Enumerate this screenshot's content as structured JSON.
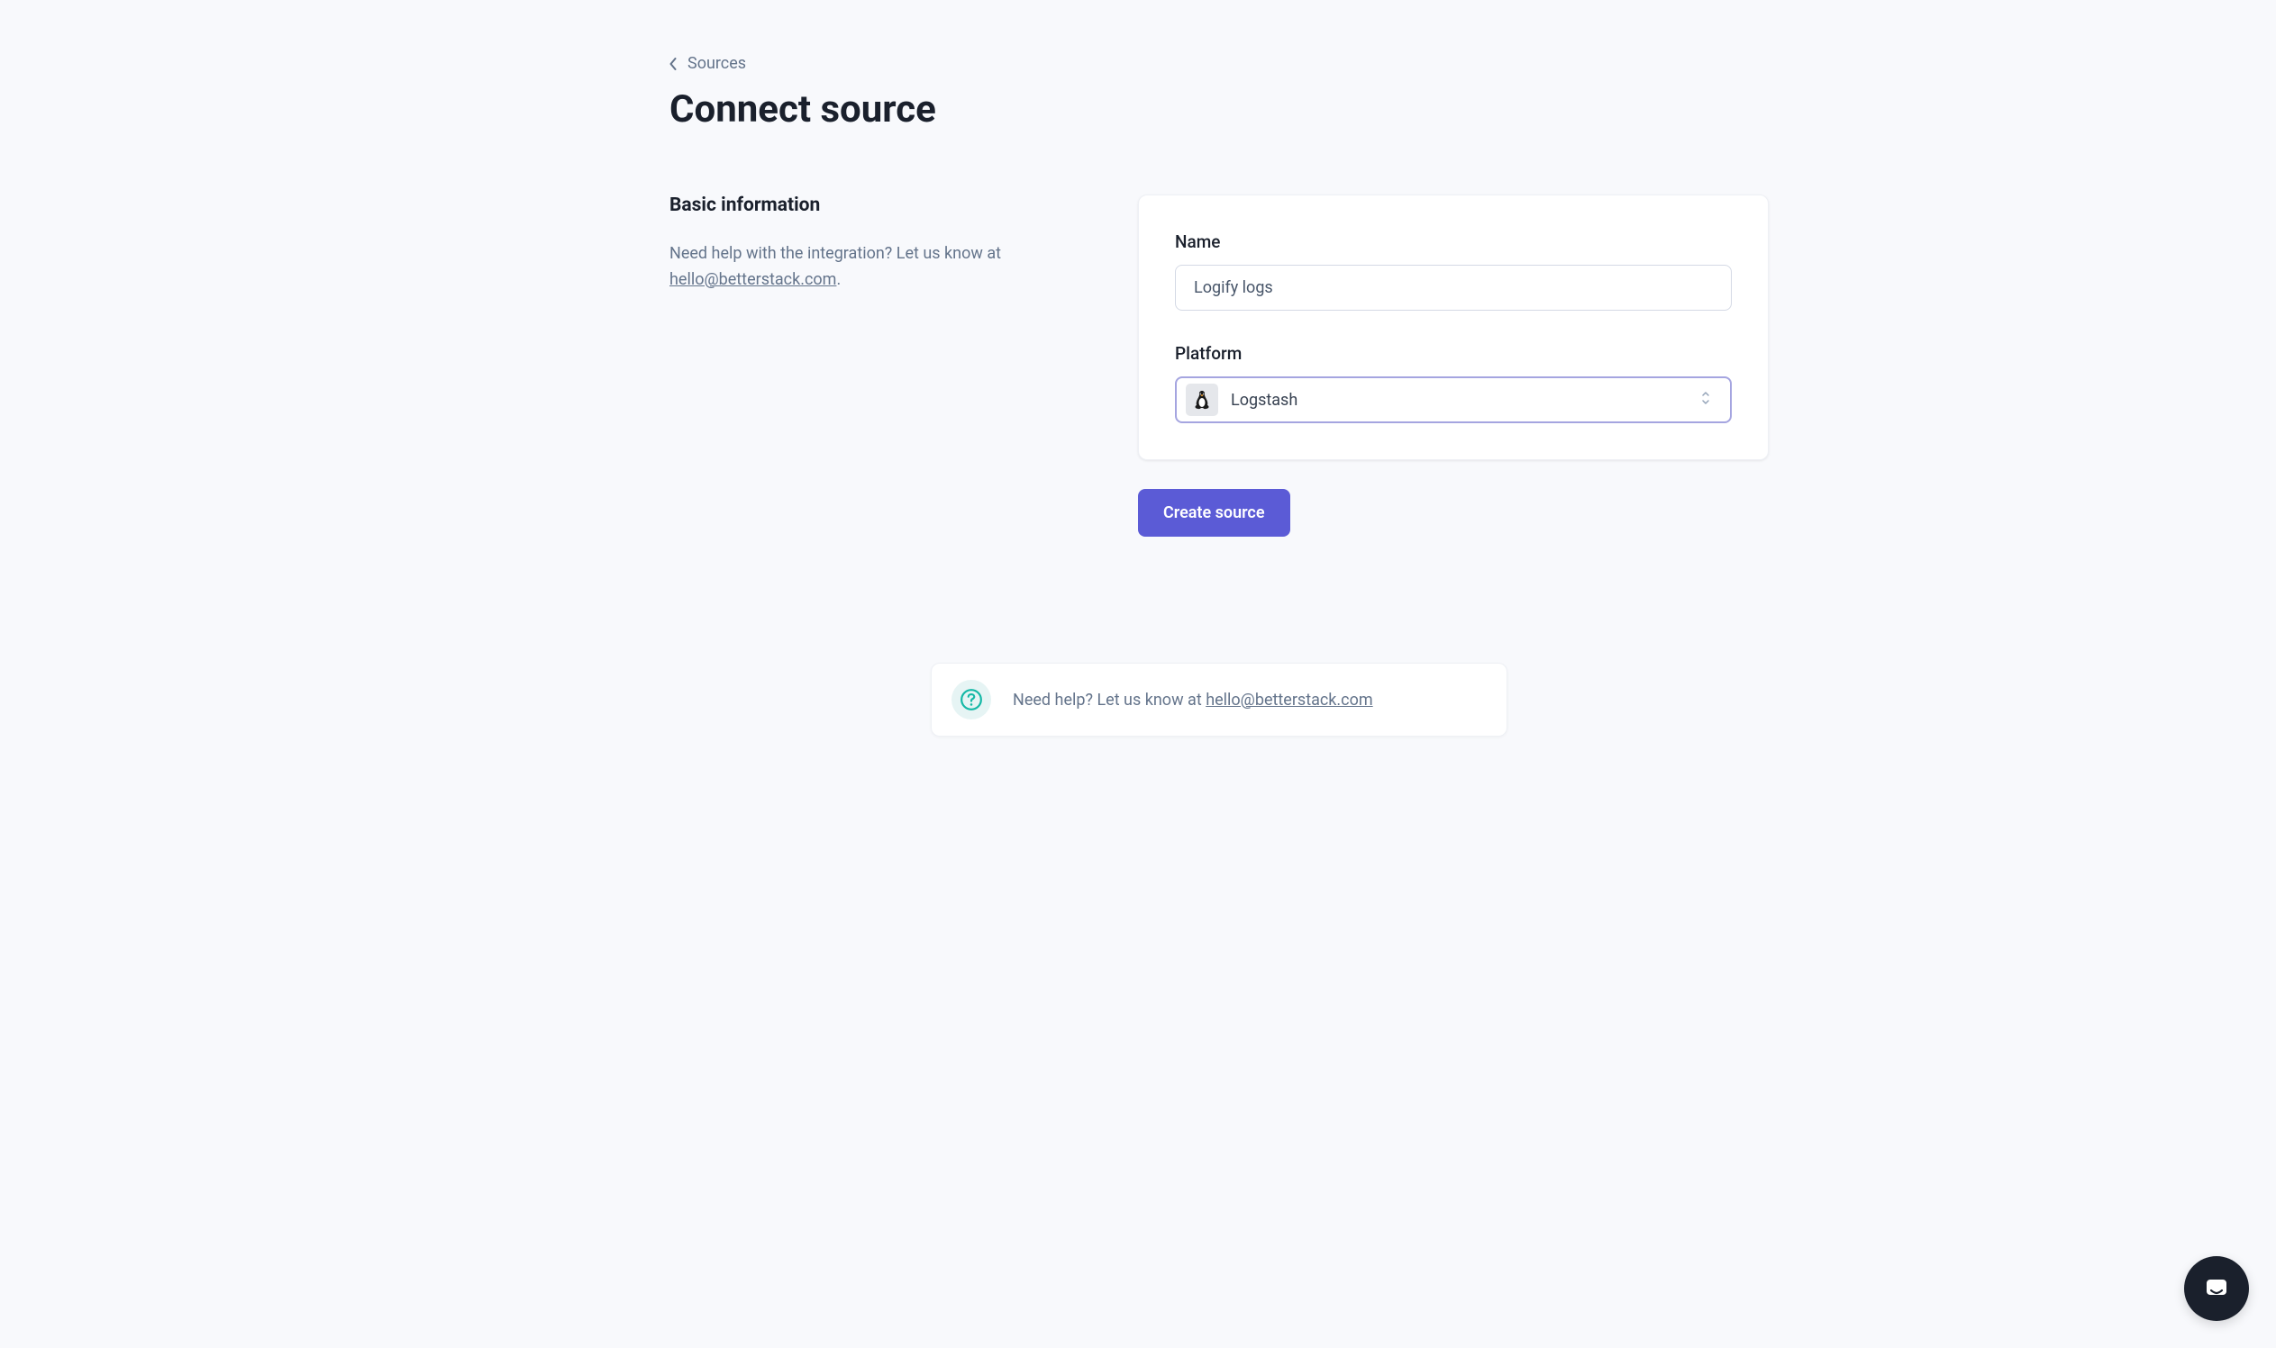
{
  "breadcrumb": {
    "parent": "Sources"
  },
  "page": {
    "title": "Connect source"
  },
  "sidebar": {
    "section_title": "Basic information",
    "help_prefix": "Need help with the integration? Let us know at ",
    "help_email": "hello@betterstack.com",
    "help_suffix": "."
  },
  "form": {
    "name_label": "Name",
    "name_value": "Logify logs",
    "platform_label": "Platform",
    "platform_value": "Logstash",
    "submit_label": "Create source"
  },
  "help_banner": {
    "prefix": "Need help? Let us know at ",
    "email": "hello@betterstack.com"
  }
}
